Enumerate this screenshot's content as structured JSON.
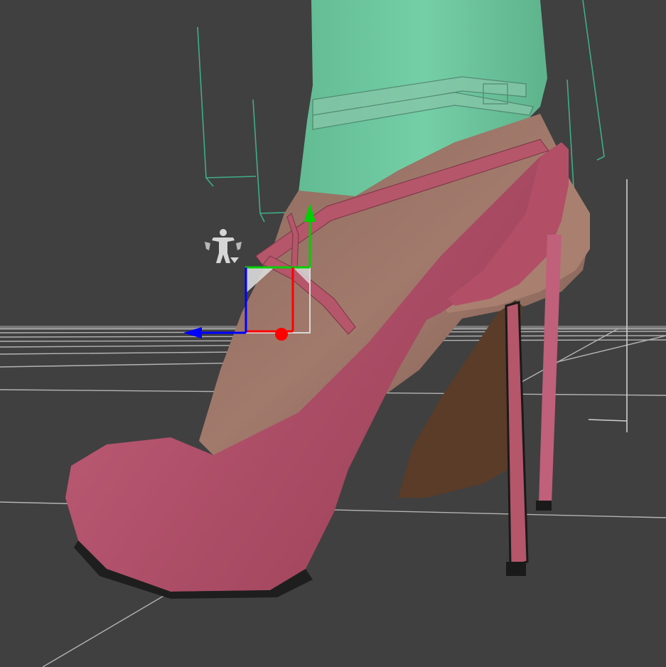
{
  "viewport": {
    "background": "#404040",
    "grid_color": "#bfbfbf",
    "bounding_box_color": "#3fae86"
  },
  "scene": {
    "shoe_color": "#b5566a",
    "shoe_highlight": "#c7667a",
    "sole_color": "#5a3c28",
    "heel_tip_color": "#1a1a1a",
    "skin_color": "#9a7366",
    "clothing_color": "#6fcaa0"
  },
  "gizmo": {
    "x_axis_color": "#ff0000",
    "y_axis_color": "#00d000",
    "z_axis_color": "#0000ff",
    "plane_handle_color": "#d8d8d8"
  },
  "icons": {
    "figure_selector": "figure-pose-icon"
  }
}
